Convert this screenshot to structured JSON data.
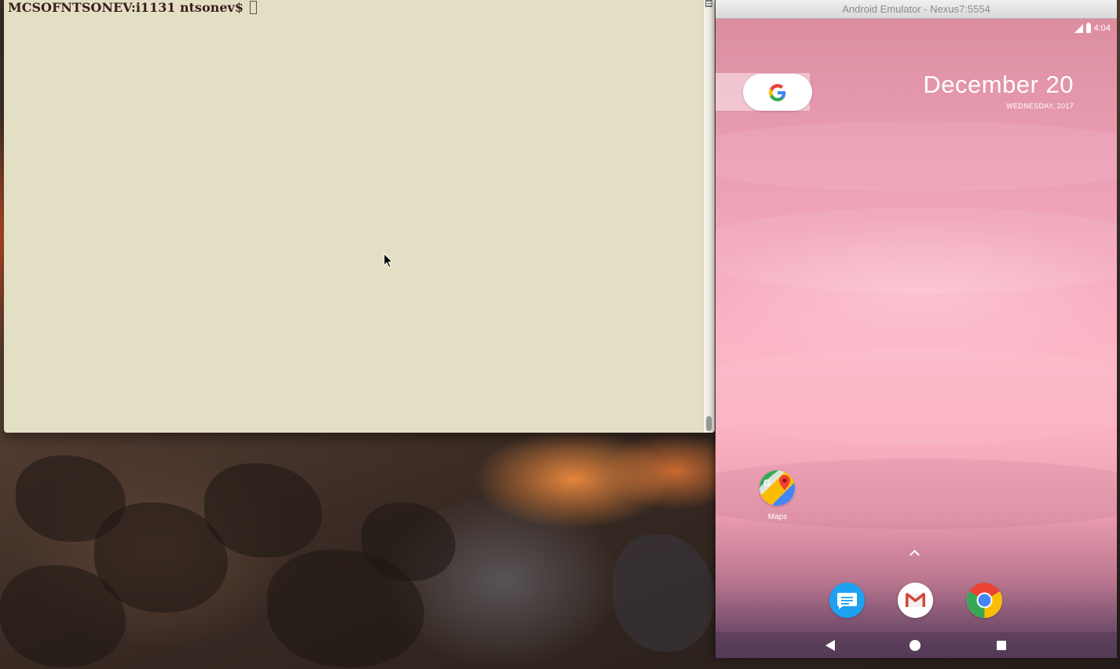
{
  "terminal": {
    "prompt": "MCSOFNTSONEV:i1131 ntsonev$ "
  },
  "emulator": {
    "title": "Android Emulator - Nexus7:5554",
    "status_bar": {
      "time": "4:04"
    },
    "google_widget": {
      "letter": "G"
    },
    "date_widget": {
      "date": "December 20",
      "subline": "WEDNESDAY, 2017"
    },
    "home_apps": [
      {
        "label": "Maps",
        "icon": "maps-icon"
      }
    ],
    "dock_apps": [
      {
        "icon": "messages-icon"
      },
      {
        "icon": "gmail-icon"
      },
      {
        "icon": "chrome-icon"
      }
    ]
  },
  "colors": {
    "terminal_background": "#e3dfc4",
    "terminal_text": "#3a1d1d",
    "screen_pink": "#f3a8bd",
    "google_blue": "#4285f4",
    "google_red": "#ea4335",
    "google_yellow": "#fbbc05",
    "google_green": "#34a853",
    "messages_blue": "#1ea1f1",
    "gmail_red": "#d44638"
  }
}
